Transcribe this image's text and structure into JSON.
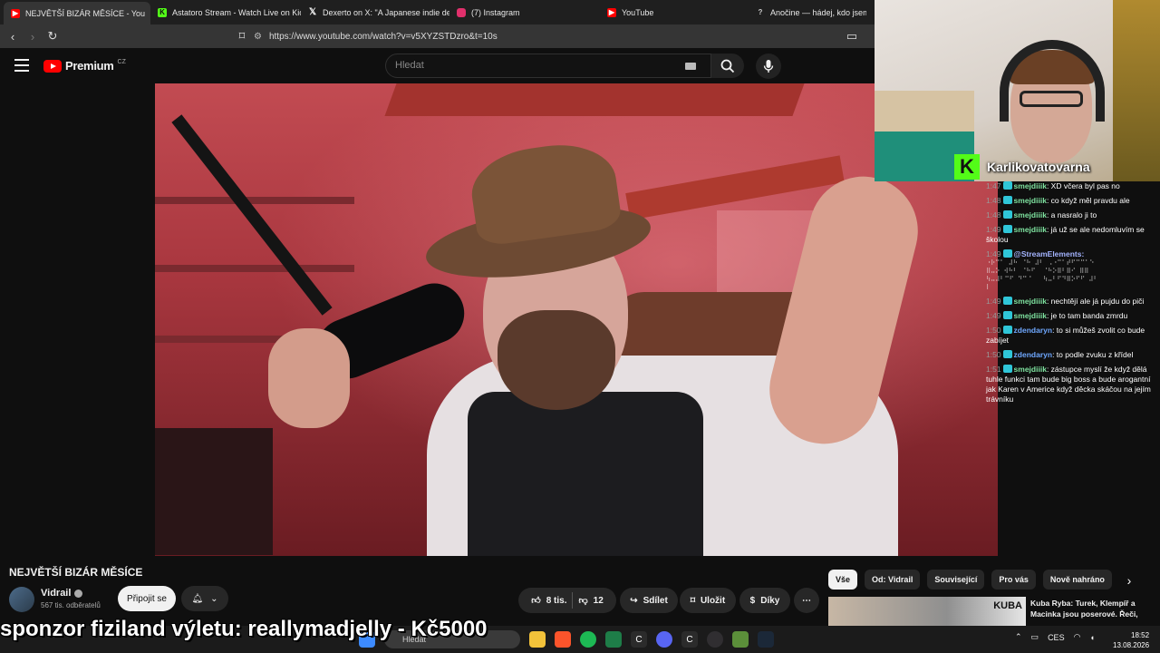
{
  "browser": {
    "tabs": [
      {
        "title": "NEJVĚTŠÍ BIZÁR MĚSÍCE - You",
        "active": true,
        "icon": "youtube-icon",
        "color": "#ff0000"
      },
      {
        "title": "Astatoro Stream - Watch Live on Kick",
        "active": false,
        "icon": "kick-icon",
        "color": "#53fc18"
      },
      {
        "title": "Dexerto on X: \"A Japanese indie dev",
        "active": false,
        "icon": "x-icon",
        "color": "#ffffff"
      },
      {
        "title": "(7) Instagram",
        "active": false,
        "icon": "instagram-icon",
        "color": "#e1306c"
      },
      {
        "title": "YouTube",
        "active": false,
        "icon": "youtube-icon",
        "color": "#ff0000"
      },
      {
        "title": "Anočine — hádej, kdo jsem",
        "active": false,
        "icon": "question-icon",
        "color": "#cccccc"
      }
    ],
    "url": "https://www.youtube.com/watch?v=v5XYZSTDzro&t=10s"
  },
  "youtube": {
    "logo": "Premium",
    "region": "CZ",
    "search_placeholder": "Hledat"
  },
  "stream": {
    "channel_name": "Karlikovatovarna",
    "chat": [
      {
        "time": "1:47",
        "user": "smejdiiik",
        "color": "#7fe3a0",
        "text": "XD včera byl pas no"
      },
      {
        "time": "1:48",
        "user": "smejdiiik",
        "color": "#7fe3a0",
        "text": "co když měl pravdu ale"
      },
      {
        "time": "1:48",
        "user": "smejdiiik",
        "color": "#7fe3a0",
        "text": "a nasralo ji to"
      },
      {
        "time": "1:49",
        "user": "smejdiiik",
        "color": "#7fe3a0",
        "text": "já už se ale nedomluvím se školou"
      },
      {
        "time": "1:49",
        "user": "@StreamElements:",
        "color": "#a4b4ff",
        "text": "",
        "ascii": "⠐⠗⠉⠁ ⠼⠓ ⠈⠓ ⠼⠃ ⠠⠐⠉⠁⠞⠋⠉⠉⠁⠑ \n⠿⠤⠕ ⠺⠓⠃ ⠈⠓⠋  ⠈⠓⠕⠿⠃⠿⠊ ⠿⠿\n⠳⠤⠼⠃⠉⠋ ⠙⠉⠈   ⠳⠤⠃⠋⠙⠿⠕⠋⠋ ⠼⠃\n⠇"
      },
      {
        "time": "1:49",
        "user": "smejdiiik",
        "color": "#7fe3a0",
        "text": "nechtějí ale já pujdu do piči"
      },
      {
        "time": "1:49",
        "user": "smejdiiik",
        "color": "#7fe3a0",
        "text": "je to tam banda zmrdu"
      },
      {
        "time": "1:50",
        "user": "zdendaryn",
        "color": "#6fa8ff",
        "text": "to si můžeš zvolit co bude zabíjet"
      },
      {
        "time": "1:50",
        "user": "zdendaryn",
        "color": "#6fa8ff",
        "text": "to podle zvuku z křídel"
      },
      {
        "time": "1:51",
        "user": "smejdiiik",
        "color": "#7fe3a0",
        "text": "zástupce myslí že když dělá tuhle funkci tam bude big boss a bude arogantní jak Karen v Americe když děcka skáčou na jejím trávníku"
      }
    ],
    "donation": "sponzor fiziland výletu: reallymadjelly - Kč5000"
  },
  "video": {
    "title": "NEJVĚTŠÍ BIZÁR MĚSÍCE",
    "channel": "Vidrail",
    "subscribers": "567 tis. odběratelů",
    "join_label": "Připojit se",
    "likes": "8 tis.",
    "dislikes": "12",
    "share_label": "Sdílet",
    "save_label": "Uložit",
    "thanks_label": "Díky"
  },
  "chips": [
    "Vše",
    "Od: Vidrail",
    "Související",
    "Pro vás",
    "Nově nahráno"
  ],
  "related": {
    "thumb_text": "KUBA",
    "title": "Kuba Ryba: Turek, Klempíř a Macinka jsou poserové. Řeči,"
  },
  "taskbar": {
    "search_label": "Hledat",
    "language": "CES",
    "time": "18:52",
    "date": "13.08.2026"
  }
}
